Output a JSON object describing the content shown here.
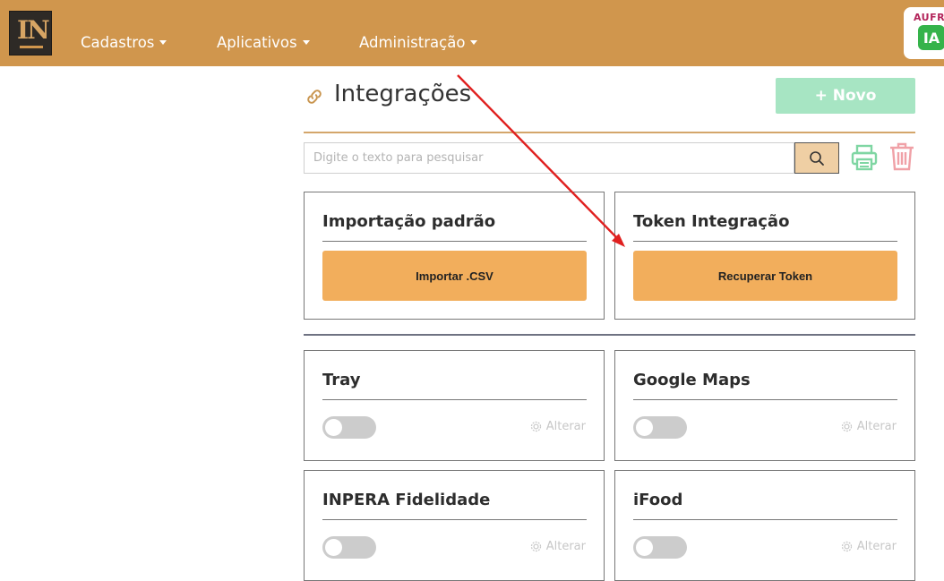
{
  "header": {
    "logo_text": "IN",
    "nav": [
      {
        "label": "Cadastros"
      },
      {
        "label": "Aplicativos"
      },
      {
        "label": "Administração"
      }
    ],
    "badge": {
      "top_text": "AUFRE",
      "bubble_text": "IA"
    },
    "bg_color": "#d0964d"
  },
  "page": {
    "title": "Integrações",
    "new_button": "+ Novo",
    "search_placeholder": "Digite o texto para pesquisar"
  },
  "action_cards": [
    {
      "title": "Importação padrão",
      "button": "Importar .CSV"
    },
    {
      "title": "Token Integração",
      "button": "Recuperar Token"
    }
  ],
  "integrations": [
    {
      "title": "Tray",
      "enabled": false,
      "action": "Alterar"
    },
    {
      "title": "Google Maps",
      "enabled": false,
      "action": "Alterar"
    },
    {
      "title": "INPERA Fidelidade",
      "enabled": false,
      "action": "Alterar"
    },
    {
      "title": "iFood",
      "enabled": false,
      "action": "Alterar"
    }
  ],
  "colors": {
    "accent": "#d0964d",
    "button_orange": "#f2ae5c",
    "new_green": "#a7e5c3",
    "annotation_red": "#e0201f"
  }
}
